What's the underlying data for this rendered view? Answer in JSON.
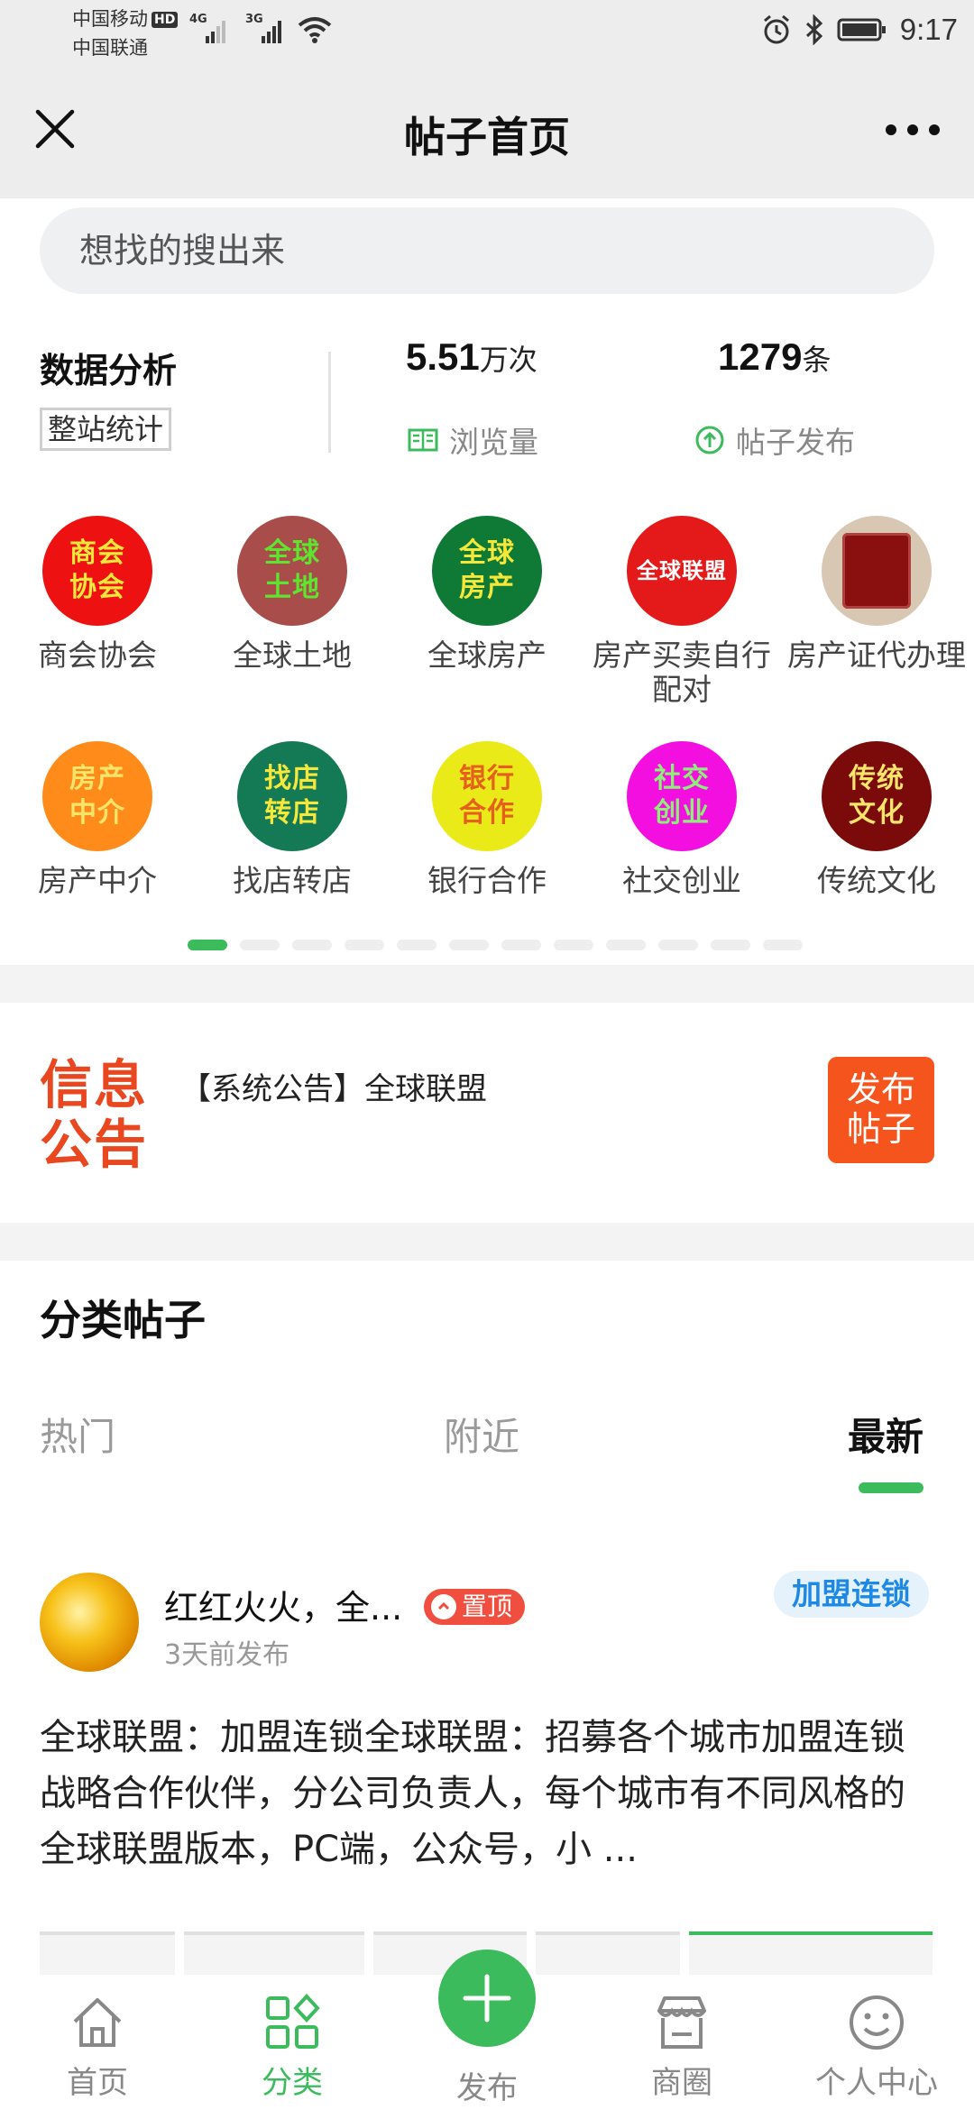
{
  "status_bar": {
    "carrier1": "中国移动",
    "carrier1_badge": "HD",
    "carrier2": "中国联通",
    "signal1": "4G",
    "signal2": "3G",
    "time": "9:17"
  },
  "nav": {
    "title": "帖子首页"
  },
  "search": {
    "placeholder": "想找的搜出来"
  },
  "stats": {
    "title": "数据分析",
    "tag": "整站统计",
    "views_value": "5.51",
    "views_unit": "万次",
    "views_label": "浏览量",
    "posts_value": "1279",
    "posts_unit": "条",
    "posts_label": "帖子发布"
  },
  "categories": [
    {
      "label": "商会协会",
      "icon_lines": [
        "商会",
        "协会"
      ],
      "bg": "#ee1111",
      "fg": "#f5e83a"
    },
    {
      "label": "全球土地",
      "icon_lines": [
        "全球",
        "土地"
      ],
      "bg": "#a94d4a",
      "fg": "#5ee52f"
    },
    {
      "label": "全球房产",
      "icon_lines": [
        "全球",
        "房产"
      ],
      "bg": "#0f7a36",
      "fg": "#f5e83a"
    },
    {
      "label": "房产买卖自行\n配对",
      "icon_lines": [
        "全球联盟"
      ],
      "bg": "#e41a1a",
      "fg": "#ffffff"
    },
    {
      "label": "房产证代办理",
      "icon_lines": [],
      "bg": "#d8c7b3",
      "fg": "#8a1010"
    },
    {
      "label": "房产中介",
      "icon_lines": [
        "房产",
        "中介"
      ],
      "bg": "#ff8c1a",
      "fg": "#f8e56a"
    },
    {
      "label": "找店转店",
      "icon_lines": [
        "找店",
        "转店"
      ],
      "bg": "#137a55",
      "fg": "#f5e83a"
    },
    {
      "label": "银行合作",
      "icon_lines": [
        "银行",
        "合作"
      ],
      "bg": "#e9ea17",
      "fg": "#e4601c"
    },
    {
      "label": "社交创业",
      "icon_lines": [
        "社交",
        "创业"
      ],
      "bg": "#f30fe0",
      "fg": "#8df078"
    },
    {
      "label": "传统文化",
      "icon_lines": [
        "传统",
        "文化"
      ],
      "bg": "#7b0a0a",
      "fg": "#f8e56a"
    }
  ],
  "pagination": {
    "total": 12,
    "active": 0
  },
  "notice": {
    "logo_line1": "信息",
    "logo_line2": "公告",
    "text": "【系统公告】全球联盟",
    "post_button_line1": "发布",
    "post_button_line2": "帖子"
  },
  "posts_section": {
    "title": "分类帖子",
    "tabs": [
      "热门",
      "附近",
      "最新"
    ],
    "active_tab": 2
  },
  "post": {
    "author": "红红火火，全...",
    "pin_label": "置顶",
    "time": "3天前发布",
    "tag": "加盟连锁",
    "body": "全球联盟：加盟连锁全球联盟：招募各个城市加盟连锁战略合作伙伴，分公司负责人，每个城市有不同风格的全球联盟版本，PC端，公众号，小 ..."
  },
  "tabbar": {
    "items": [
      {
        "label": "首页"
      },
      {
        "label": "分类"
      },
      {
        "label": "发布"
      },
      {
        "label": "商圈"
      },
      {
        "label": "个人中心"
      }
    ],
    "active": 1
  },
  "colors": {
    "accent_green": "#3cbb5c",
    "orange": "#f5541c",
    "tag_blue": "#1e88e5",
    "pin_red": "#f04e3e"
  }
}
